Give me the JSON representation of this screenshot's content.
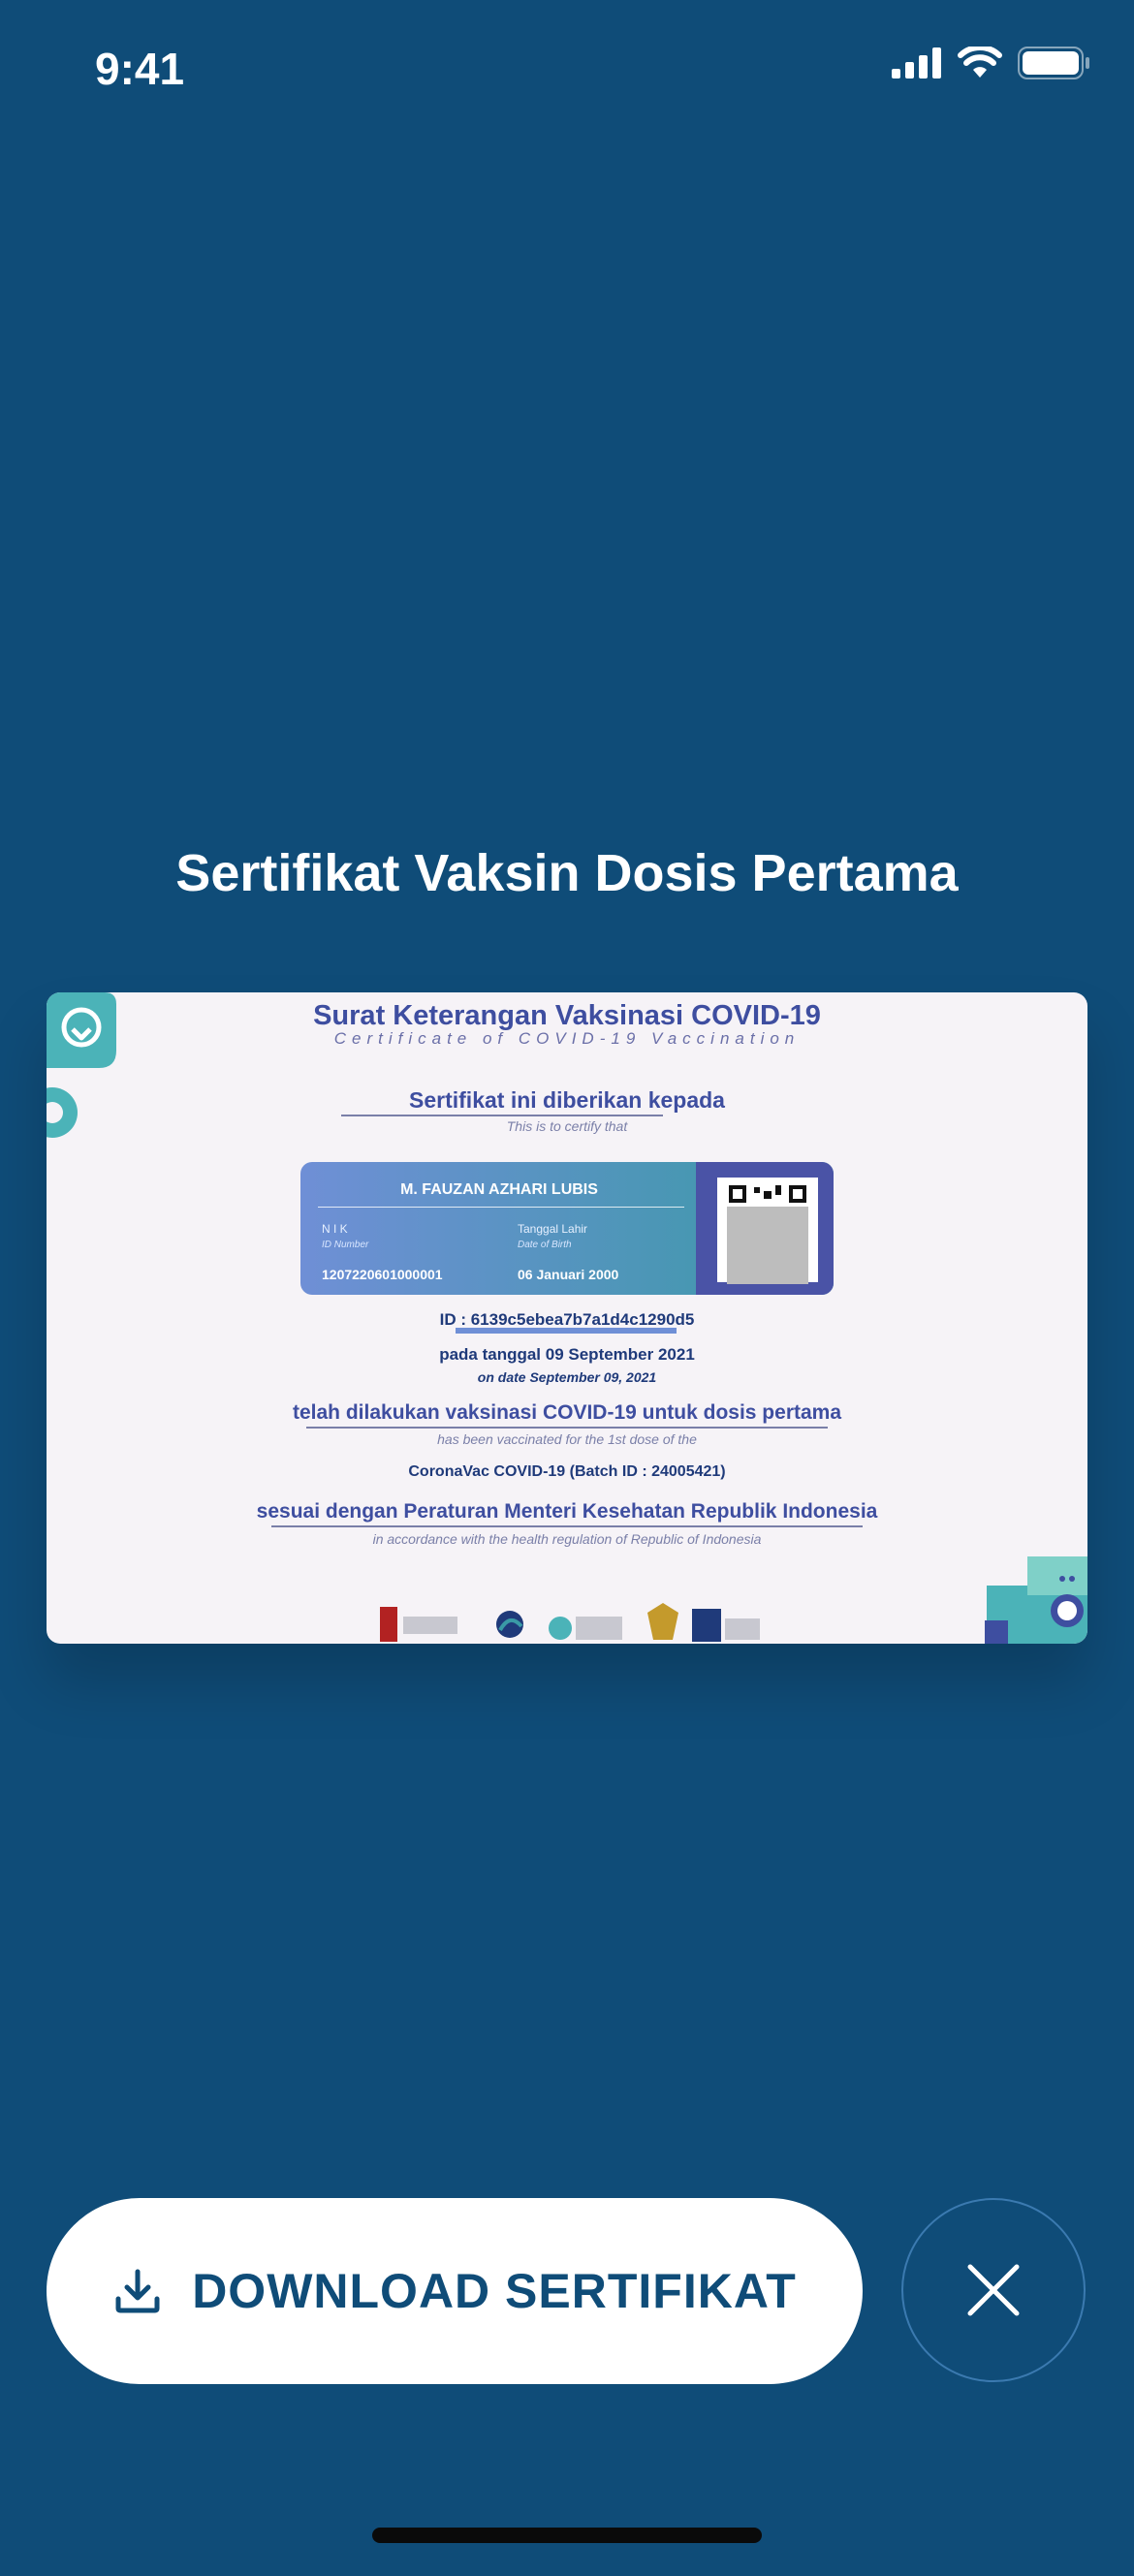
{
  "status_bar": {
    "time": "9:41"
  },
  "page_title": "Sertifikat Vaksin Dosis Pertama",
  "certificate": {
    "title": "Surat Keterangan Vaksinasi COVID-19",
    "subtitle": "Certificate of COVID-19 Vaccination",
    "given_to": "Sertifikat ini diberikan kepada",
    "certify_en": "This is to certify that",
    "name": "M. FAUZAN AZHARI LUBIS",
    "nik_label": "N I K",
    "nik_label_en": "ID Number",
    "nik_value": "1207220601000001",
    "dob_label": "Tanggal Lahir",
    "dob_label_en": "Date of Birth",
    "dob_value": "06 Januari 2000",
    "id_line": "ID : 6139c5ebea7b7a1d4c1290d5",
    "date_line": "pada tanggal 09 September 2021",
    "date_line_en": "on date September 09, 2021",
    "vaccinated_line": "telah dilakukan vaksinasi COVID-19 untuk dosis pertama",
    "vaccinated_line_en": "has been vaccinated for the 1st dose of the",
    "vaccine": "CoronaVac COVID-19 (Batch ID : 24005421)",
    "regulation_line": "sesuai dengan Peraturan Menteri Kesehatan Republik Indonesia",
    "regulation_line_en": "in accordance with the health regulation of Republic of Indonesia"
  },
  "actions": {
    "download_label": "DOWNLOAD SERTIFIKAT",
    "download_icon": "download-icon",
    "close_icon": "close-icon"
  },
  "colors": {
    "background": "#0f4c78",
    "accent": "#3e4ea0",
    "button_text": "#0f4c78"
  }
}
